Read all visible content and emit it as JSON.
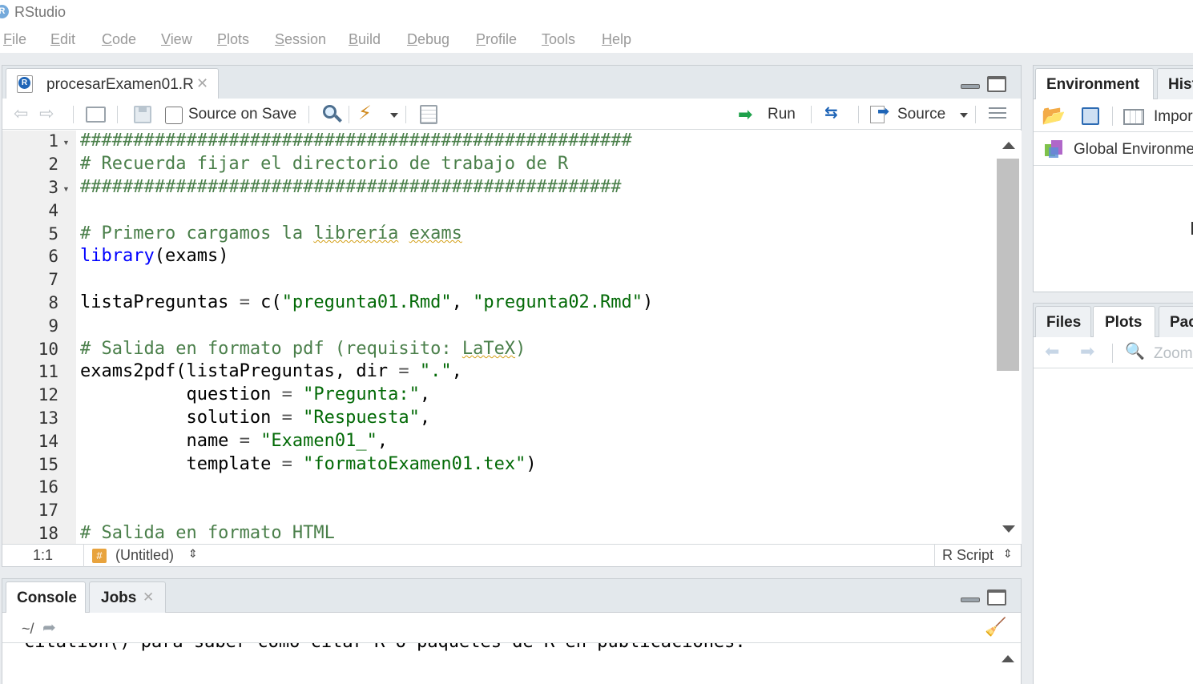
{
  "app": {
    "title": "RStudio",
    "icon_letter": "R"
  },
  "menu": [
    {
      "label": "File",
      "ul": "F",
      "rest": "ile"
    },
    {
      "label": "Edit",
      "ul": "E",
      "rest": "dit"
    },
    {
      "label": "Code",
      "ul": "C",
      "rest": "ode"
    },
    {
      "label": "View",
      "ul": "V",
      "rest": "iew"
    },
    {
      "label": "Plots",
      "ul": "P",
      "rest": "lots"
    },
    {
      "label": "Session",
      "ul": "S",
      "rest": "ession"
    },
    {
      "label": "Build",
      "ul": "B",
      "rest": "uild"
    },
    {
      "label": "Debug",
      "ul": "D",
      "rest": "ebug"
    },
    {
      "label": "Profile",
      "ul": "P",
      "rest": "rofile"
    },
    {
      "label": "Tools",
      "ul": "T",
      "rest": "ools"
    },
    {
      "label": "Help",
      "ul": "H",
      "rest": "elp"
    }
  ],
  "editor": {
    "tab_label": "procesarExamen01.R",
    "toolbar": {
      "source_on_save": "Source on Save",
      "run": "Run",
      "source": "Source"
    },
    "line_numbers": [
      "1",
      "2",
      "3",
      "4",
      "5",
      "6",
      "7",
      "8",
      "9",
      "10",
      "11",
      "12",
      "13",
      "14",
      "15",
      "16",
      "17",
      "18"
    ],
    "code": [
      "####################################################",
      "# Recuerda fijar el directorio de trabajo de R",
      "###################################################",
      "",
      "# Primero cargamos la librería exams",
      "library(exams)",
      "",
      "listaPreguntas = c(\"pregunta01.Rmd\", \"pregunta02.Rmd\")",
      "",
      "# Salida en formato pdf (requisito: LaTeX)",
      "exams2pdf(listaPreguntas, dir = \".\",",
      "          question = \"Pregunta:\",",
      "          solution = \"Respuesta\",",
      "          name = \"Examen01_\",",
      "          template = \"formatoExamen01.tex\")",
      "",
      "",
      "# Salida en formato HTML"
    ],
    "status": {
      "position": "1:1",
      "scope": "(Untitled)",
      "file_type": "R Script"
    }
  },
  "console": {
    "tabs": [
      "Console",
      "Jobs"
    ],
    "path": "~/",
    "lines": [
      "citation() para saber cómo citar R o paquetes de R en publicaciones."
    ]
  },
  "environment_pane": {
    "tabs": [
      "Environment",
      "Hist"
    ],
    "import_label": "Impor",
    "scope": "Global Environme"
  },
  "files_pane": {
    "tabs": [
      "Files",
      "Plots",
      "Pac"
    ],
    "zoom_label": "Zoom"
  },
  "colors": {
    "comment": "#4a7f4a",
    "string": "#036a07",
    "keyword": "#0000ff",
    "run_arrow": "#1ea14a"
  }
}
